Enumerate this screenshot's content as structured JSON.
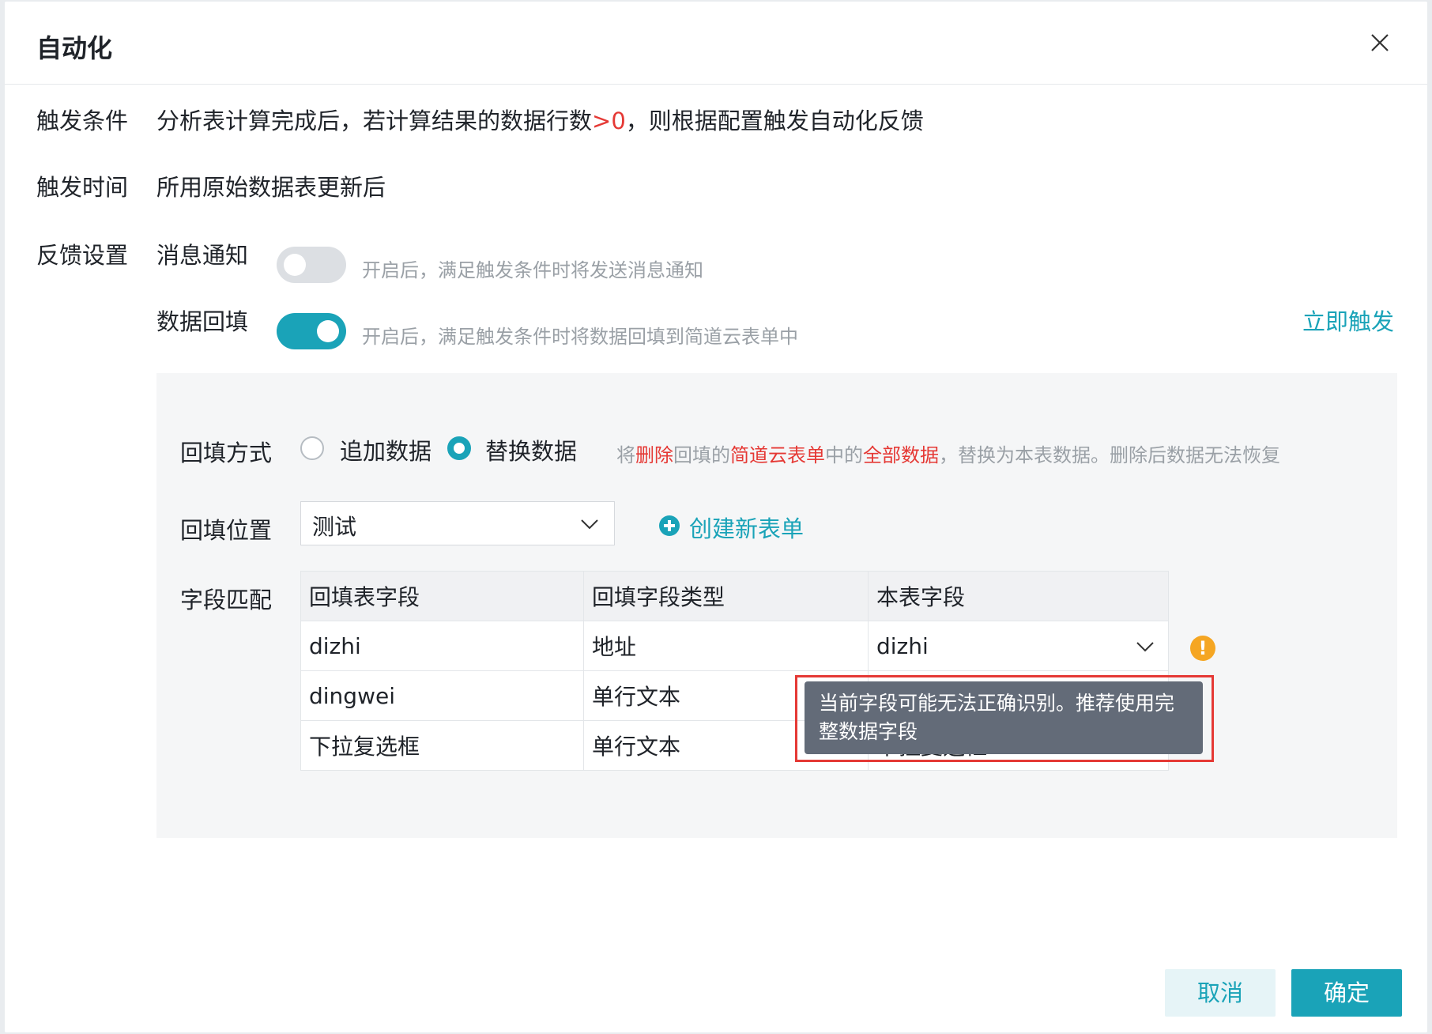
{
  "dialog": {
    "title": "自动化"
  },
  "trigger_condition": {
    "label": "触发条件",
    "text_before": "分析表计算完成后，若计算结果的数据行数",
    "highlight": ">0",
    "text_after": "，则根据配置触发自动化反馈"
  },
  "trigger_time": {
    "label": "触发时间",
    "value": "所用原始数据表更新后"
  },
  "feedback": {
    "label": "反馈设置",
    "notify": {
      "label": "消息通知",
      "enabled": false,
      "hint": "开启后，满足触发条件时将发送消息通知"
    },
    "backfill": {
      "label": "数据回填",
      "enabled": true,
      "hint": "开启后，满足触发条件时将数据回填到简道云表单中",
      "trigger_now": "立即触发"
    }
  },
  "backfill_mode": {
    "label": "回填方式",
    "options": [
      {
        "label": "追加数据",
        "selected": false
      },
      {
        "label": "替换数据",
        "selected": true
      }
    ],
    "warning": {
      "p1": "将",
      "p2": "删除",
      "p3": "回填的",
      "p4": "简道云表单",
      "p5": "中的",
      "p6": "全部数据",
      "p7": "，替换为本表数据。删除后数据无法恢复"
    }
  },
  "backfill_location": {
    "label": "回填位置",
    "selected": "测试",
    "create_new": "创建新表单"
  },
  "field_mapping": {
    "label": "字段匹配",
    "headers": [
      "回填表字段",
      "回填字段类型",
      "本表字段"
    ],
    "rows": [
      [
        "dizhi",
        "地址",
        "dizhi"
      ],
      [
        "dingwei",
        "单行文本",
        ""
      ],
      [
        "下拉复选框",
        "单行文本",
        "下拉复选框"
      ]
    ],
    "warning_icon": "!",
    "tooltip": "当前字段可能无法正确识别。推荐使用完整数据字段"
  },
  "footer": {
    "cancel": "取消",
    "confirm": "确定"
  },
  "colors": {
    "accent": "#1aa3b8",
    "danger": "#e53935",
    "warning": "#f5a623",
    "tooltip_bg": "#636b78"
  }
}
